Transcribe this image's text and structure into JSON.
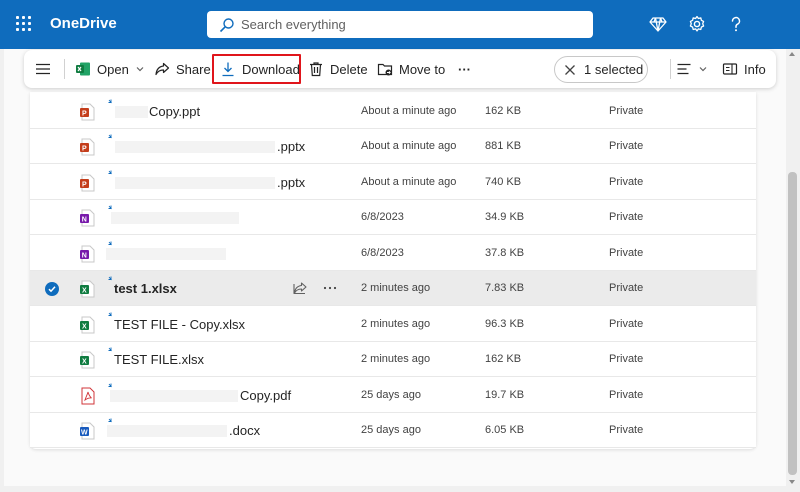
{
  "app": {
    "title": "OneDrive",
    "search_placeholder": "Search everything"
  },
  "commandbar": {
    "open_label": "Open",
    "share_label": "Share",
    "download_label": "Download",
    "delete_label": "Delete",
    "moveto_label": "Move to",
    "more_label": "···",
    "selected_label": "1 selected",
    "info_label": "Info"
  },
  "files": [
    {
      "name": "Copy.ppt",
      "type": "ppt",
      "modified": "About a minute ago",
      "size": "162 KB",
      "sharing": "Private"
    },
    {
      "name": ".pptx",
      "type": "ppt",
      "modified": "About a minute ago",
      "size": "881 KB",
      "sharing": "Private"
    },
    {
      "name": ".pptx",
      "type": "ppt",
      "modified": "About a minute ago",
      "size": "740 KB",
      "sharing": "Private"
    },
    {
      "name": "",
      "type": "onenote",
      "modified": "6/8/2023",
      "size": "34.9 KB",
      "sharing": "Private"
    },
    {
      "name": "",
      "type": "onenote",
      "modified": "6/8/2023",
      "size": "37.8 KB",
      "sharing": "Private"
    },
    {
      "name": "test 1.xlsx",
      "type": "xlsx",
      "modified": "2 minutes ago",
      "size": "7.83 KB",
      "sharing": "Private",
      "selected": true
    },
    {
      "name": "TEST FILE - Copy.xlsx",
      "type": "xlsx",
      "modified": "2 minutes ago",
      "size": "96.3 KB",
      "sharing": "Private"
    },
    {
      "name": "TEST FILE.xlsx",
      "type": "xlsx",
      "modified": "2 minutes ago",
      "size": "162 KB",
      "sharing": "Private"
    },
    {
      "name": "Copy.pdf",
      "type": "pdf",
      "modified": "25 days ago",
      "size": "19.7 KB",
      "sharing": "Private"
    },
    {
      "name": ".docx",
      "type": "docx",
      "modified": "25 days ago",
      "size": "6.05 KB",
      "sharing": "Private"
    }
  ],
  "colors": {
    "brand": "#0f6cbd",
    "highlight": "#e0151b",
    "ppt": "#c43e1c",
    "onenote": "#7719aa",
    "xlsx": "#107c41",
    "pdf": "#d13438",
    "docx": "#185abd"
  },
  "icons": {
    "topbar": [
      "app-launcher-icon",
      "premium-diamond-icon",
      "settings-gear-icon",
      "help-icon"
    ],
    "commandbar": [
      "menu-icon",
      "excel-icon",
      "share-icon",
      "download-icon",
      "delete-icon",
      "move-to-icon",
      "more-icon",
      "close-icon",
      "view-options-icon",
      "info-icon"
    ]
  }
}
